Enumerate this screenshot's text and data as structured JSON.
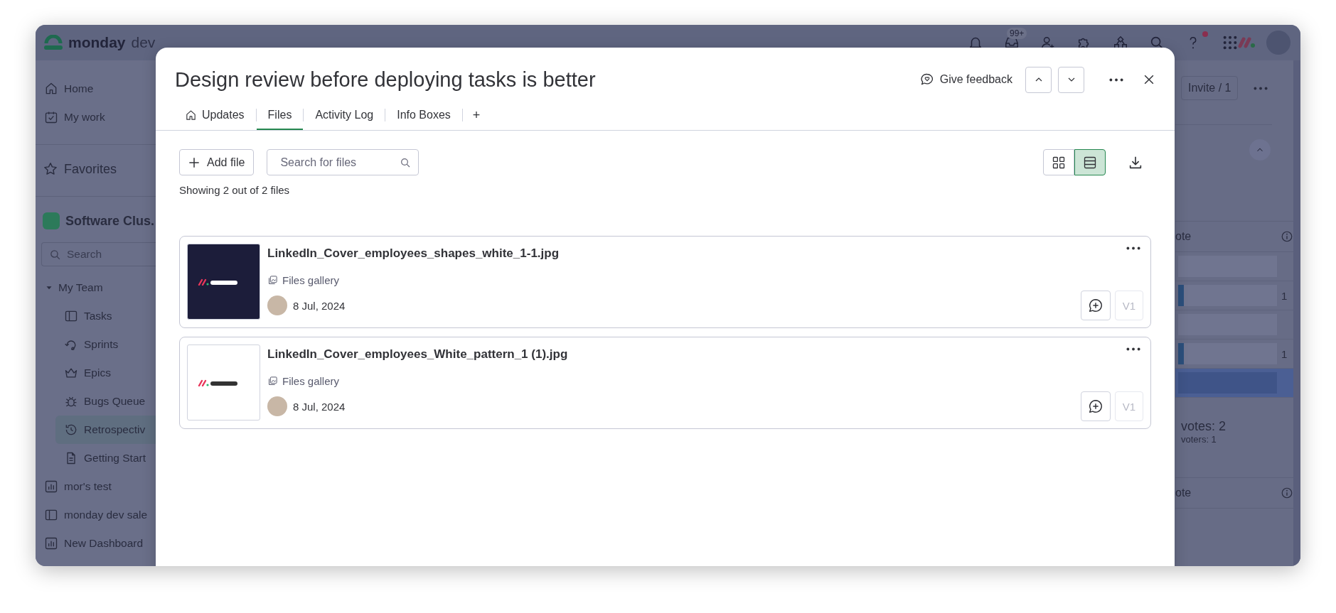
{
  "topbar": {
    "logo": "monday",
    "product": "dev",
    "inbox_badge": "99+",
    "help_notification": true
  },
  "sidebar": {
    "items": [
      {
        "label": "Home"
      },
      {
        "label": "My work"
      }
    ],
    "favorites": "Favorites",
    "workspace": "Software Clus.",
    "search_placeholder": "Search",
    "folder": {
      "label": "My Team",
      "children": [
        {
          "label": "Tasks",
          "selected": false
        },
        {
          "label": "Sprints",
          "selected": false
        },
        {
          "label": "Epics",
          "selected": false
        },
        {
          "label": "Bugs Queue",
          "selected": false
        },
        {
          "label": "Retrospectiv",
          "selected": true
        },
        {
          "label": "Getting Start",
          "selected": false
        }
      ]
    },
    "boards": [
      {
        "label": "mor's test",
        "selected": false
      },
      {
        "label": "monday dev sale",
        "selected": false
      },
      {
        "label": "New Dashboard",
        "selected": false
      }
    ]
  },
  "background": {
    "invite": "Invite / 1",
    "column_header": "ote",
    "rows": [
      {
        "selected": false
      },
      {
        "level": 0.06,
        "count": "1",
        "selected": false
      },
      {
        "selected": false
      },
      {
        "level": 0.06,
        "count": "1",
        "selected": false
      },
      {
        "selected": true
      }
    ],
    "votes": "votes: 2",
    "voters": "voters: 1",
    "column_header_2": "ote"
  },
  "modal": {
    "title": "Design review before deploying tasks is better",
    "feedback": "Give feedback",
    "tabs": [
      {
        "label": "Updates",
        "selected": false
      },
      {
        "label": "Files",
        "selected": true
      },
      {
        "label": "Activity Log",
        "selected": false
      },
      {
        "label": "Info Boxes",
        "selected": false
      }
    ],
    "add_tab": "+",
    "add_file": "Add file",
    "search_placeholder": "Search for files",
    "views": [
      {
        "kind": "grid",
        "selected": false
      },
      {
        "kind": "list",
        "selected": true
      }
    ],
    "summary": "Showing 2 out of 2 files",
    "files": [
      {
        "name": "LinkedIn_Cover_employees_shapes_white_1-1.jpg",
        "source": "Files gallery",
        "date": "8 Jul, 2024",
        "version": "V1"
      },
      {
        "name": "LinkedIn_Cover_employees_White_pattern_1 (1).jpg",
        "source": "Files gallery",
        "date": "8 Jul, 2024",
        "version": "V1"
      }
    ]
  }
}
